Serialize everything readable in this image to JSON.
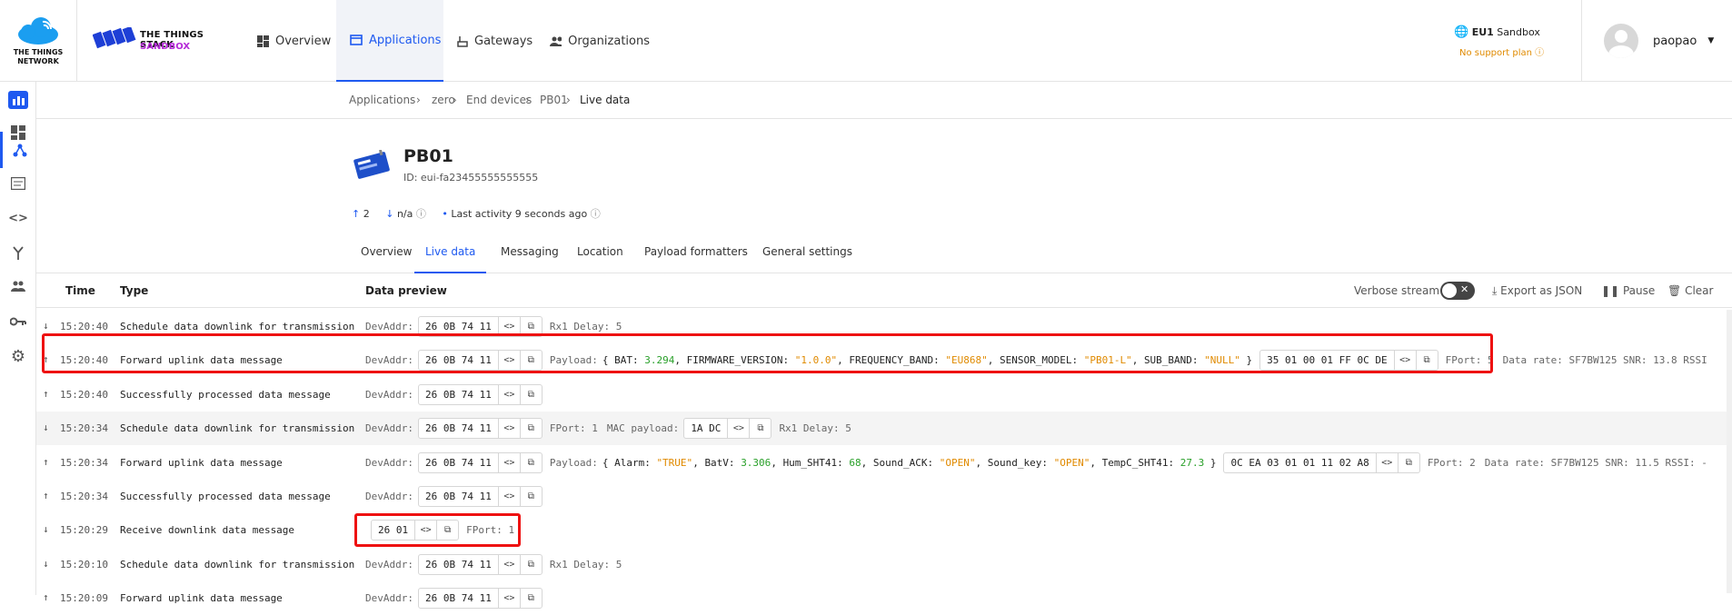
{
  "brand": {
    "ttn_line1": "THE THINGS",
    "ttn_line2": "NETWORK",
    "stack_line1": "THE THINGS STACK",
    "stack_line2": "SANDBOX"
  },
  "nav": [
    {
      "label": "Overview"
    },
    {
      "label": "Applications"
    },
    {
      "label": "Gateways"
    },
    {
      "label": "Organizations"
    }
  ],
  "region": {
    "name": "EU1",
    "suffix": "Sandbox",
    "support": "No support plan"
  },
  "user": {
    "name": "paopao"
  },
  "breadcrumb": [
    "Applications",
    "zero",
    "End devices",
    "PB01",
    "Live data"
  ],
  "device": {
    "name": "PB01",
    "id": "ID: eui-fa23455555555555",
    "up_count": "2",
    "down_count": "n/a",
    "last_activity": "Last activity 9 seconds ago"
  },
  "tabs": [
    "Overview",
    "Live data",
    "Messaging",
    "Location",
    "Payload formatters",
    "General settings"
  ],
  "table": {
    "headers": {
      "time": "Time",
      "type": "Type",
      "preview": "Data preview"
    },
    "controls": {
      "verbose": "Verbose stream",
      "export": "Export as JSON",
      "pause": "Pause",
      "clear": "Clear"
    },
    "rows": [
      {
        "dir": "down",
        "time": "15:20:40",
        "type": "Schedule data downlink for transmission",
        "devaddr": "26 0B 74 11",
        "rest": "Rx1 Delay: 5"
      },
      {
        "dir": "up",
        "time": "15:20:40",
        "type": "Forward uplink data message",
        "devaddr": "26 0B 74 11",
        "payload_label": "Payload:",
        "payload": [
          [
            "BAT",
            "3.294",
            "num"
          ],
          [
            "FIRMWARE_VERSION",
            "\"1.0.0\"",
            "str"
          ],
          [
            "FREQUENCY_BAND",
            "\"EU868\"",
            "str"
          ],
          [
            "SENSOR_MODEL",
            "\"PB01-L\"",
            "str"
          ],
          [
            "SUB_BAND",
            "\"NULL\"",
            "str"
          ]
        ],
        "raw": "35 01 00 01 FF 0C DE",
        "fport": "FPort: 5",
        "extra": "Data rate: SF7BW125  SNR: 13.8  RSSI"
      },
      {
        "dir": "up",
        "time": "15:20:40",
        "type": "Successfully processed data message",
        "devaddr": "26 0B 74 11"
      },
      {
        "dir": "down",
        "time": "15:20:34",
        "type": "Schedule data downlink for transmission",
        "devaddr": "26 0B 74 11",
        "fport": "FPort: 1",
        "mac_label": "MAC payload:",
        "mac": "1A DC",
        "rest": "Rx1 Delay: 5"
      },
      {
        "dir": "up",
        "time": "15:20:34",
        "type": "Forward uplink data message",
        "devaddr": "26 0B 74 11",
        "payload_label": "Payload:",
        "payload": [
          [
            "Alarm",
            "\"TRUE\"",
            "str"
          ],
          [
            "BatV",
            "3.306",
            "num"
          ],
          [
            "Hum_SHT41",
            "68",
            "num"
          ],
          [
            "Sound_ACK",
            "\"OPEN\"",
            "str"
          ],
          [
            "Sound_key",
            "\"OPEN\"",
            "str"
          ],
          [
            "TempC_SHT41",
            "27.3",
            "num"
          ]
        ],
        "raw": "0C EA 03 01 01 11 02 A8",
        "fport": "FPort: 2",
        "extra": "Data rate: SF7BW125  SNR: 11.5  RSSI: -"
      },
      {
        "dir": "up",
        "time": "15:20:34",
        "type": "Successfully processed data message",
        "devaddr": "26 0B 74 11"
      },
      {
        "dir": "down",
        "time": "15:20:29",
        "type": "Receive downlink data message",
        "raw": "26 01",
        "fport": "FPort: 1"
      },
      {
        "dir": "down",
        "time": "15:20:10",
        "type": "Schedule data downlink for transmission",
        "devaddr": "26 0B 74 11",
        "rest": "Rx1 Delay: 5"
      },
      {
        "dir": "up",
        "time": "15:20:09",
        "type": "Forward uplink data message",
        "devaddr": "26 0B 74 11"
      }
    ]
  }
}
